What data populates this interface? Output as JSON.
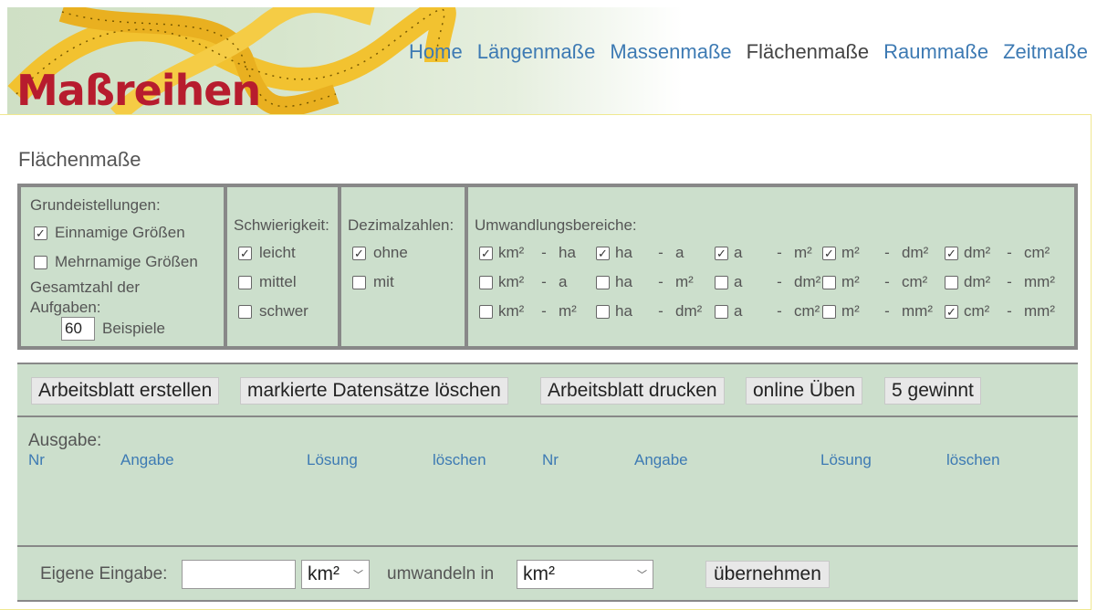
{
  "header": {
    "logo_text": "Maßreihen",
    "nav": [
      {
        "label": "Home",
        "active": false
      },
      {
        "label": "Längenmaße",
        "active": false
      },
      {
        "label": "Massenmaße",
        "active": false
      },
      {
        "label": "Flächenmaße",
        "active": true
      },
      {
        "label": "Raummaße",
        "active": false
      },
      {
        "label": "Zeitmaße",
        "active": false
      }
    ]
  },
  "page_title": "Flächenmaße",
  "settings": {
    "grund": {
      "heading": "Grundeistellungen:",
      "opt_einnamig": "Einnamige Größen",
      "opt_einnamig_checked": true,
      "opt_mehrnamig": "Mehrnamige Größen",
      "opt_mehrnamig_checked": false,
      "total_label_1": "Gesamtzahl der",
      "total_label_2": "Aufgaben:",
      "total_value": "60",
      "total_suffix": "Beispiele"
    },
    "schwierigkeit": {
      "heading": "Schwierigkeit:",
      "options": [
        {
          "label": "leicht",
          "checked": true
        },
        {
          "label": "mittel",
          "checked": false
        },
        {
          "label": "schwer",
          "checked": false
        }
      ]
    },
    "dezimal": {
      "heading": "Dezimalzahlen:",
      "options": [
        {
          "label": "ohne",
          "checked": true
        },
        {
          "label": "mit",
          "checked": false
        }
      ]
    },
    "bereiche": {
      "heading": "Umwandlungsbereiche:",
      "rows": [
        [
          {
            "a": "km²",
            "b": "ha",
            "checked": true
          },
          {
            "a": "ha",
            "b": "a",
            "checked": true
          },
          {
            "a": "a",
            "b": "m²",
            "checked": true
          },
          {
            "a": "m²",
            "b": "dm²",
            "checked": true
          },
          {
            "a": "dm²",
            "b": "cm²",
            "checked": true
          }
        ],
        [
          {
            "a": "km²",
            "b": "a",
            "checked": false
          },
          {
            "a": "ha",
            "b": "m²",
            "checked": false
          },
          {
            "a": "a",
            "b": "dm²",
            "checked": false
          },
          {
            "a": "m²",
            "b": "cm²",
            "checked": false
          },
          {
            "a": "dm²",
            "b": "mm²",
            "checked": false
          }
        ],
        [
          {
            "a": "km²",
            "b": "m²",
            "checked": false
          },
          {
            "a": "ha",
            "b": "dm²",
            "checked": false
          },
          {
            "a": "a",
            "b": "cm²",
            "checked": false
          },
          {
            "a": "m²",
            "b": "mm²",
            "checked": false
          },
          {
            "a": "cm²",
            "b": "mm²",
            "checked": true
          }
        ]
      ]
    }
  },
  "buttons": {
    "create": "Arbeitsblatt erstellen",
    "delete": "markierte Datensätze löschen",
    "print": "Arbeitsblatt drucken",
    "practice": "online Üben",
    "game": "5 gewinnt"
  },
  "output": {
    "label": "Ausgabe:",
    "columns": [
      "Nr",
      "Angabe",
      "Lösung",
      "löschen",
      "Nr",
      "Angabe",
      "Lösung",
      "löschen"
    ]
  },
  "own_input": {
    "label": "Eigene Eingabe:",
    "value": "",
    "from_unit": "km²",
    "convert_label": "umwandeln in",
    "to_unit": "km²",
    "apply": "übernehmen"
  },
  "check_mark": "✓",
  "dash": "-"
}
